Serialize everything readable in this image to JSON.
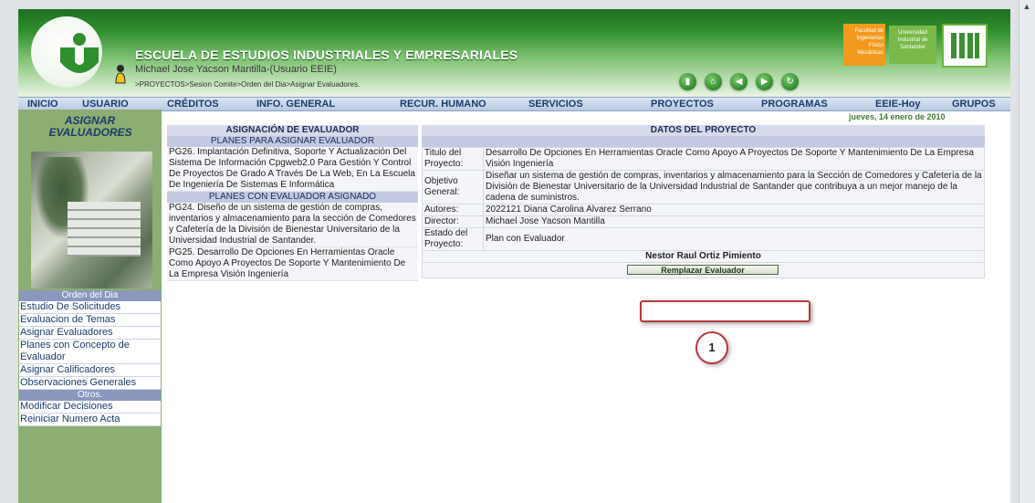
{
  "header": {
    "title": "ESCUELA DE ESTUDIOS INDUSTRIALES Y EMPRESARIALES",
    "user": "Michael Jose Yacson Mantilla-(Usuario EEIE)",
    "breadcrumb": ">PROYECTOS>Sesion Comite>Orden del Dia>Asignar Evaluadores.",
    "faculty_logo": "Facultad de Ingenierías Físico Mecánicas",
    "uni_logo": "Universidad Industrial de Santander"
  },
  "menu": [
    "INICIO",
    "USUARIO",
    "CRÉDITOS",
    "INFO. GENERAL",
    "RECUR. HUMANO",
    "SERVICIOS",
    "PROYECTOS",
    "PROGRAMAS",
    "EEIE-Hoy",
    "GRUPOS"
  ],
  "date": "jueves, 14 enero de 2010",
  "sidebar": {
    "title": "ASIGNAR EVALUADORES",
    "section1": "Orden del Dia",
    "items1": [
      "Estudio De Solicitudes",
      "Evaluacion de Temas",
      "Asignar Evaluadores",
      "Planes con Concepto de Evaluador",
      "Asignar Calificadores",
      "Observaciones Generales"
    ],
    "section2": "Otros.",
    "items2": [
      "Modificar Decisiones",
      "Reiniciar Numero Acta"
    ]
  },
  "left": {
    "header": "ASIGNACIÓN DE EVALUADOR",
    "sub1": "PLANES PARA ASIGNAR EVALUADOR",
    "plan_unassigned": "PG26. Implantación Definitiva, Soporte Y Actualización Del Sistema De Información Cpgweb2.0 Para Gestión Y Control De Proyectos De Grado A Través De La Web, En La Escuela De Ingeniería De Sistemas E Informática",
    "sub2": "PLANES CON EVALUADOR ASIGNADO",
    "plans_assigned": [
      "PG24. Diseño de un sistema de gestión de compras, inventarios y almacenamiento para la sección de Comedores y Cafetería de la División de Bienestar Universitario de la Universidad Industrial de Santander.",
      "PG25. Desarrollo De Opciones En Herramientas Oracle Como Apoyo A Proyectos De Soporte Y Mantenimiento De La Empresa Visión Ingeniería"
    ]
  },
  "project": {
    "header": "DATOS DEL PROYECTO",
    "labels": {
      "title": "Titulo del Proyecto:",
      "objective": "Objetivo General:",
      "authors": "Autores:",
      "director": "Director:",
      "status": "Estado del Proyecto:"
    },
    "title": "Desarrollo De Opciones En Herramientas Oracle Como Apoyo A Proyectos De Soporte Y Mantenimiento De La Empresa Visión Ingeniería",
    "objective": "Diseñar un sistema de gestión de compras, inventarios y almacenamiento para la Sección de Comedores y Cafetería de la División de Bienestar Universitario de la Universidad Industrial de Santander que contribuya a un mejor manejo de la cadena de suministros.",
    "authors": "2022121 Diana Carolina Alvarez Serrano",
    "director": "Michael Jose Yacson Mantilla",
    "status": "Plan con Evaluador",
    "evaluator": "Nestor Raul Ortiz Pimiento",
    "replace_button": "Remplazar Evaluador"
  },
  "callout": "1",
  "colors": {
    "header_green": "#2f8f2e",
    "sidebar_green": "#8cae72",
    "menu_blue": "#1a3c6e",
    "annotation_red": "#b73a3a"
  }
}
